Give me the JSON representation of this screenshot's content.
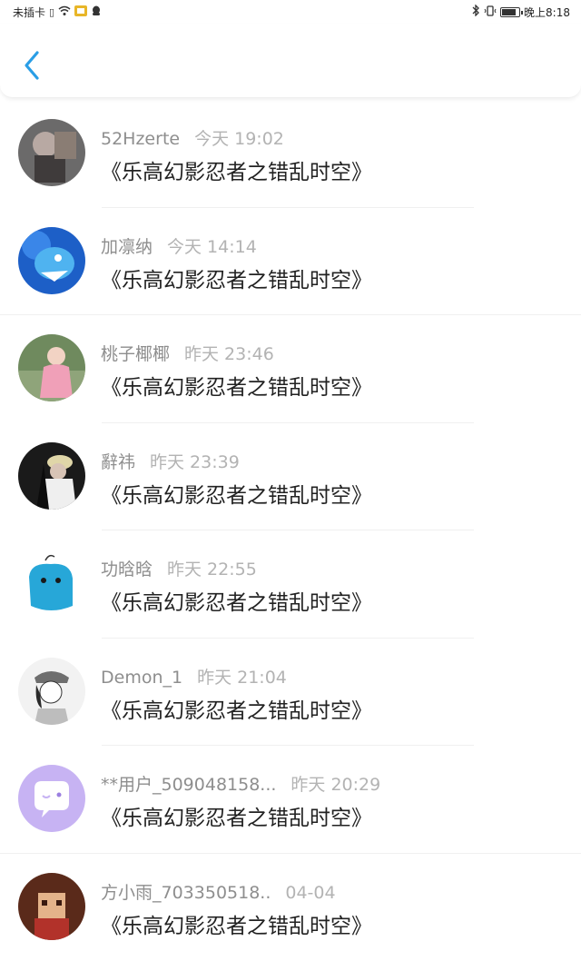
{
  "status_bar": {
    "carrier": "未插卡",
    "time": "晚上8:18",
    "battery_level": 0.85
  },
  "header": {
    "accent_color": "#2a9ee6"
  },
  "notes_list": [
    {
      "username": "52Hzerte",
      "time": "今天 19:02",
      "title": "《乐高幻影忍者之错乱时空》"
    },
    {
      "username": "加凛纳",
      "time": "今天 14:14",
      "title": "《乐高幻影忍者之错乱时空》"
    },
    {
      "username": "桃子椰椰",
      "time": "昨天 23:46",
      "title": "《乐高幻影忍者之错乱时空》"
    },
    {
      "username": "辭祎",
      "time": "昨天 23:39",
      "title": "《乐高幻影忍者之错乱时空》"
    },
    {
      "username": "功晗晗",
      "time": "昨天 22:55",
      "title": "《乐高幻影忍者之错乱时空》"
    },
    {
      "username": "Demon_1",
      "time": "昨天 21:04",
      "title": "《乐高幻影忍者之错乱时空》"
    },
    {
      "username": "**用户_509048158...",
      "time": "昨天 20:29",
      "title": "《乐高幻影忍者之错乱时空》"
    },
    {
      "username": "方小雨_703350518..",
      "time": "04-04",
      "title": "《乐高幻影忍者之错乱时空》"
    }
  ]
}
